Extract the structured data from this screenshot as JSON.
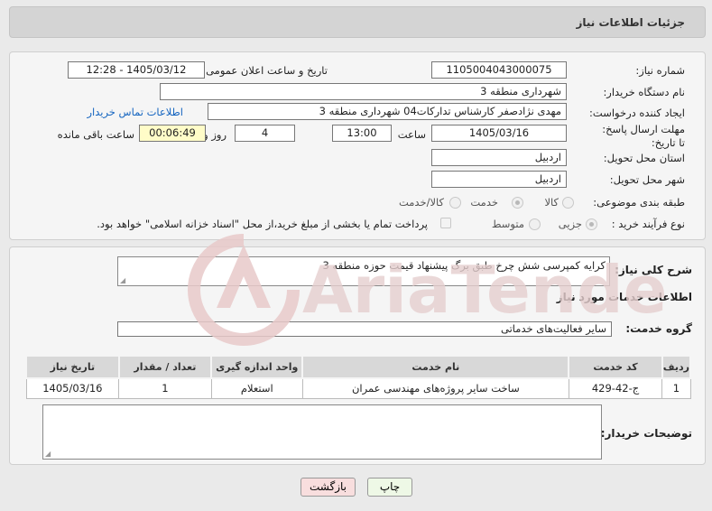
{
  "header": {
    "title": "جزئیات اطلاعات نیاز"
  },
  "form": {
    "need_number": {
      "label": "شماره نیاز:",
      "value": "1105004043000075"
    },
    "announce": {
      "label": "تاریخ و ساعت اعلان عمومی:",
      "value": "1405/03/12 - 12:28"
    },
    "buyer_org": {
      "label": "نام دستگاه خریدار:",
      "value": "شهرداری منطقه 3"
    },
    "requester": {
      "label": "ایجاد کننده درخواست:",
      "value": "مهدی نژادصفر کارشناس تدارکات04 شهرداری منطقه 3"
    },
    "contact_link": "اطلاعات تماس خریدار",
    "deadline": {
      "label": "مهلت ارسال پاسخ: تا تاریخ:",
      "date": "1405/03/16",
      "time_label": "ساعت",
      "time": "13:00",
      "days": "4",
      "days_label": "روز و",
      "remaining": "00:06:49",
      "remaining_label": "ساعت باقی مانده"
    },
    "province": {
      "label": "استان محل تحویل:",
      "value": "اردبیل"
    },
    "city": {
      "label": "شهر محل تحویل:",
      "value": "اردبیل"
    },
    "category": {
      "label": "طبقه بندی موضوعی:",
      "options": [
        "کالا",
        "خدمت",
        "کالا/خدمت"
      ],
      "selected": "خدمت"
    },
    "process": {
      "label": "نوع فرآیند خرید :",
      "options": [
        "جزیی",
        "متوسط"
      ],
      "selected": "جزیی",
      "payment_note": "پرداخت تمام یا بخشی از مبلغ خرید،از محل \"اسناد خزانه اسلامی\" خواهد بود."
    }
  },
  "details": {
    "summary_label": "شرح کلی نیاز:",
    "summary": "کرایه کمپرسی شش چرخ طبق برگ پیشنهاد قیمت حوزه منطقه 3",
    "services_title": "اطلاعات خدمات مورد نیاز",
    "group_label": "گروه خدمت:",
    "group": "سایر فعالیت‌های خدماتی",
    "table": {
      "headers": [
        "ردیف",
        "کد خدمت",
        "نام خدمت",
        "واحد اندازه گیری",
        "تعداد / مقدار",
        "تاریخ نیاز"
      ],
      "rows": [
        [
          "1",
          "ج-42-429",
          "ساخت سایر پروژه‌های مهندسی عمران",
          "استعلام",
          "1",
          "1405/03/16"
        ]
      ]
    },
    "buyer_notes_label": "توضیحات خریدار:"
  },
  "buttons": {
    "print": "چاپ",
    "back": "بازگشت"
  },
  "colors": {
    "back_button": "#f8dede",
    "print_button": "#eef8e6",
    "remaining_box": "#fffcc8",
    "watermark": "#e8c9c9"
  },
  "watermark": {
    "text": "AriaTender.net"
  }
}
